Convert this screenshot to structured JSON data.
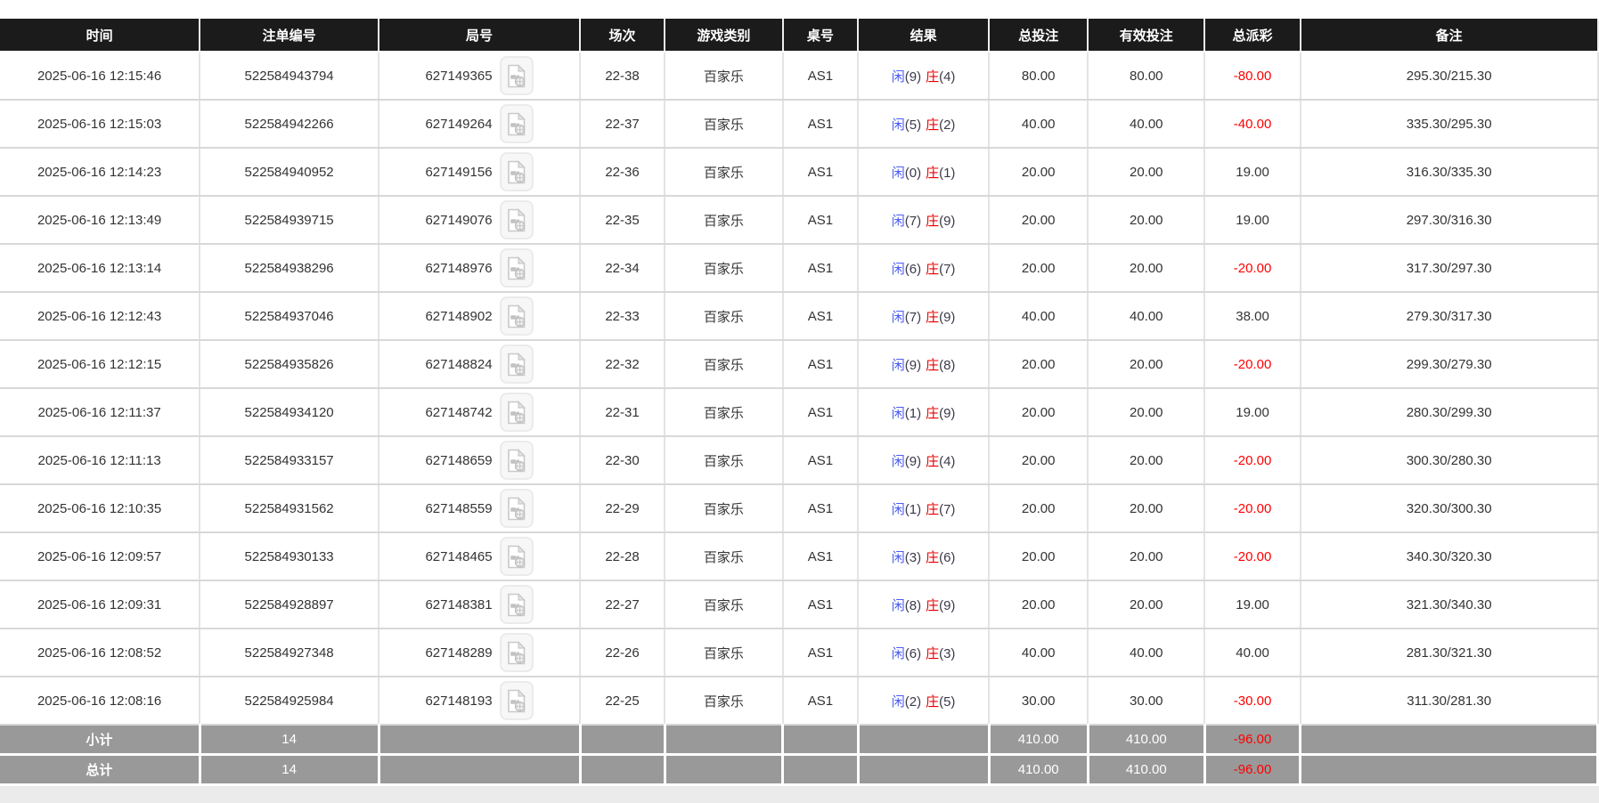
{
  "colors": {
    "header_bg": "#1b1b1b",
    "bet_amount_blue": "#2b6bff",
    "player_blue": "#4a5cf2",
    "banker_red": "#e60000",
    "negative_red": "#ff0000",
    "summary_bg": "#999999"
  },
  "table": {
    "columns": [
      {
        "label": "时间"
      },
      {
        "label": "注单编号"
      },
      {
        "label": "局号"
      },
      {
        "label": "场次"
      },
      {
        "label": "游戏类别"
      },
      {
        "label": "桌号"
      },
      {
        "label": "结果"
      },
      {
        "label": "总投注"
      },
      {
        "label": "有效投注"
      },
      {
        "label": "总派彩"
      },
      {
        "label": "备注"
      }
    ],
    "video_icon": "video-replay-icon",
    "rows": [
      {
        "time": "2025-06-16 12:15:46",
        "bet_id": "522584943794",
        "round": "627149365",
        "session": "22-38",
        "game_type": "百家乐",
        "table_no": "AS1",
        "player": "闲",
        "player_score": "(9)",
        "banker": "庄",
        "banker_score": "(4)",
        "total_bet": "80.00",
        "valid_bet": "80.00",
        "total_payout": "-80.00",
        "remark": "295.30/215.30"
      },
      {
        "time": "2025-06-16 12:15:03",
        "bet_id": "522584942266",
        "round": "627149264",
        "session": "22-37",
        "game_type": "百家乐",
        "table_no": "AS1",
        "player": "闲",
        "player_score": "(5)",
        "banker": "庄",
        "banker_score": "(2)",
        "total_bet": "40.00",
        "valid_bet": "40.00",
        "total_payout": "-40.00",
        "remark": "335.30/295.30"
      },
      {
        "time": "2025-06-16 12:14:23",
        "bet_id": "522584940952",
        "round": "627149156",
        "session": "22-36",
        "game_type": "百家乐",
        "table_no": "AS1",
        "player": "闲",
        "player_score": "(0)",
        "banker": "庄",
        "banker_score": "(1)",
        "total_bet": "20.00",
        "valid_bet": "20.00",
        "total_payout": "19.00",
        "remark": "316.30/335.30"
      },
      {
        "time": "2025-06-16 12:13:49",
        "bet_id": "522584939715",
        "round": "627149076",
        "session": "22-35",
        "game_type": "百家乐",
        "table_no": "AS1",
        "player": "闲",
        "player_score": "(7)",
        "banker": "庄",
        "banker_score": "(9)",
        "total_bet": "20.00",
        "valid_bet": "20.00",
        "total_payout": "19.00",
        "remark": "297.30/316.30"
      },
      {
        "time": "2025-06-16 12:13:14",
        "bet_id": "522584938296",
        "round": "627148976",
        "session": "22-34",
        "game_type": "百家乐",
        "table_no": "AS1",
        "player": "闲",
        "player_score": "(6)",
        "banker": "庄",
        "banker_score": "(7)",
        "total_bet": "20.00",
        "valid_bet": "20.00",
        "total_payout": "-20.00",
        "remark": "317.30/297.30"
      },
      {
        "time": "2025-06-16 12:12:43",
        "bet_id": "522584937046",
        "round": "627148902",
        "session": "22-33",
        "game_type": "百家乐",
        "table_no": "AS1",
        "player": "闲",
        "player_score": "(7)",
        "banker": "庄",
        "banker_score": "(9)",
        "total_bet": "40.00",
        "valid_bet": "40.00",
        "total_payout": "38.00",
        "remark": "279.30/317.30"
      },
      {
        "time": "2025-06-16 12:12:15",
        "bet_id": "522584935826",
        "round": "627148824",
        "session": "22-32",
        "game_type": "百家乐",
        "table_no": "AS1",
        "player": "闲",
        "player_score": "(9)",
        "banker": "庄",
        "banker_score": "(8)",
        "total_bet": "20.00",
        "valid_bet": "20.00",
        "total_payout": "-20.00",
        "remark": "299.30/279.30"
      },
      {
        "time": "2025-06-16 12:11:37",
        "bet_id": "522584934120",
        "round": "627148742",
        "session": "22-31",
        "game_type": "百家乐",
        "table_no": "AS1",
        "player": "闲",
        "player_score": "(1)",
        "banker": "庄",
        "banker_score": "(9)",
        "total_bet": "20.00",
        "valid_bet": "20.00",
        "total_payout": "19.00",
        "remark": "280.30/299.30"
      },
      {
        "time": "2025-06-16 12:11:13",
        "bet_id": "522584933157",
        "round": "627148659",
        "session": "22-30",
        "game_type": "百家乐",
        "table_no": "AS1",
        "player": "闲",
        "player_score": "(9)",
        "banker": "庄",
        "banker_score": "(4)",
        "total_bet": "20.00",
        "valid_bet": "20.00",
        "total_payout": "-20.00",
        "remark": "300.30/280.30"
      },
      {
        "time": "2025-06-16 12:10:35",
        "bet_id": "522584931562",
        "round": "627148559",
        "session": "22-29",
        "game_type": "百家乐",
        "table_no": "AS1",
        "player": "闲",
        "player_score": "(1)",
        "banker": "庄",
        "banker_score": "(7)",
        "total_bet": "20.00",
        "valid_bet": "20.00",
        "total_payout": "-20.00",
        "remark": "320.30/300.30"
      },
      {
        "time": "2025-06-16 12:09:57",
        "bet_id": "522584930133",
        "round": "627148465",
        "session": "22-28",
        "game_type": "百家乐",
        "table_no": "AS1",
        "player": "闲",
        "player_score": "(3)",
        "banker": "庄",
        "banker_score": "(6)",
        "total_bet": "20.00",
        "valid_bet": "20.00",
        "total_payout": "-20.00",
        "remark": "340.30/320.30"
      },
      {
        "time": "2025-06-16 12:09:31",
        "bet_id": "522584928897",
        "round": "627148381",
        "session": "22-27",
        "game_type": "百家乐",
        "table_no": "AS1",
        "player": "闲",
        "player_score": "(8)",
        "banker": "庄",
        "banker_score": "(9)",
        "total_bet": "20.00",
        "valid_bet": "20.00",
        "total_payout": "19.00",
        "remark": "321.30/340.30"
      },
      {
        "time": "2025-06-16 12:08:52",
        "bet_id": "522584927348",
        "round": "627148289",
        "session": "22-26",
        "game_type": "百家乐",
        "table_no": "AS1",
        "player": "闲",
        "player_score": "(6)",
        "banker": "庄",
        "banker_score": "(3)",
        "total_bet": "40.00",
        "valid_bet": "40.00",
        "total_payout": "40.00",
        "remark": "281.30/321.30"
      },
      {
        "time": "2025-06-16 12:08:16",
        "bet_id": "522584925984",
        "round": "627148193",
        "session": "22-25",
        "game_type": "百家乐",
        "table_no": "AS1",
        "player": "闲",
        "player_score": "(2)",
        "banker": "庄",
        "banker_score": "(5)",
        "total_bet": "30.00",
        "valid_bet": "30.00",
        "total_payout": "-30.00",
        "remark": "311.30/281.30"
      }
    ],
    "summary_rows": [
      {
        "label": "小计",
        "count": "14",
        "total_bet": "410.00",
        "valid_bet": "410.00",
        "total_payout": "-96.00"
      },
      {
        "label": "总计",
        "count": "14",
        "total_bet": "410.00",
        "valid_bet": "410.00",
        "total_payout": "-96.00"
      }
    ]
  }
}
